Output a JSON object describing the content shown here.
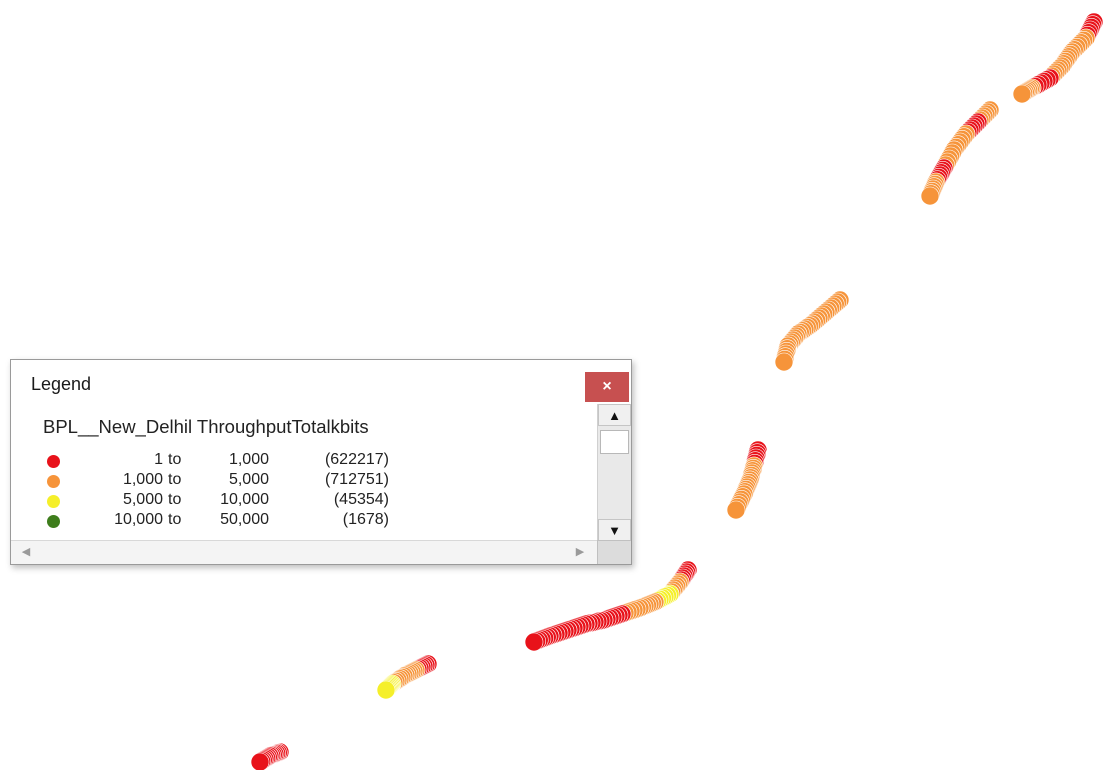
{
  "map": {
    "classes": [
      {
        "color": "#e8121a"
      },
      {
        "color": "#f6943a"
      },
      {
        "color": "#f5ef2a"
      },
      {
        "color": "#3e7d1c"
      }
    ]
  },
  "legend": {
    "title": "Legend",
    "close_label": "×",
    "layer_name": "BPL__New_Delhil ThroughputTotalkbits",
    "items": [
      {
        "low": "1",
        "to": "to",
        "high": "1,000",
        "count": "(622217)",
        "color": "#e8121a"
      },
      {
        "low": "1,000",
        "to": "to",
        "high": "5,000",
        "count": "(712751)",
        "color": "#f6943a"
      },
      {
        "low": "5,000",
        "to": "to",
        "high": "10,000",
        "count": "(45354)",
        "color": "#f5ef2a"
      },
      {
        "low": "10,000",
        "to": "to",
        "high": "50,000",
        "count": "(1678)",
        "color": "#3e7d1c"
      }
    ],
    "scroll_up_icon": "▲",
    "scroll_down_icon": "▼",
    "scroll_left_icon": "◀",
    "scroll_right_icon": "▶"
  }
}
